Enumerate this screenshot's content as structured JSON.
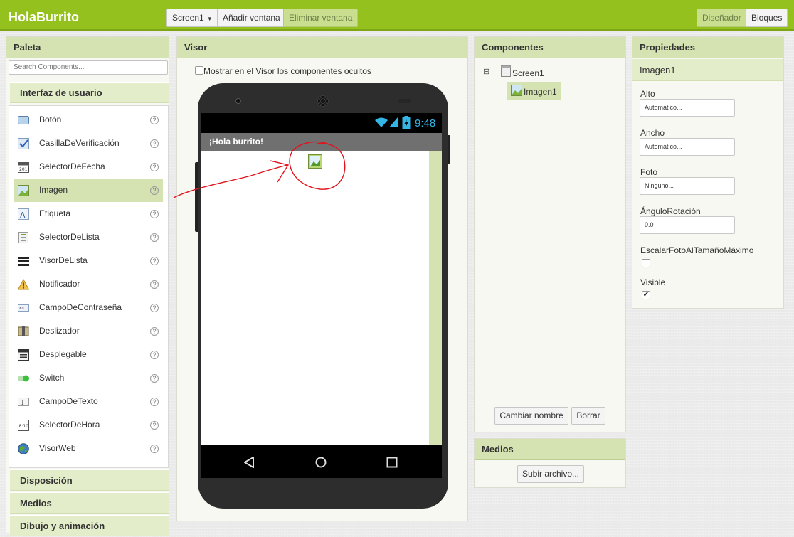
{
  "app": {
    "title": "HolaBurrito"
  },
  "toolbar": {
    "screen_select": "Screen1",
    "add_screen": "Añadir ventana",
    "remove_screen": "Eliminar ventana",
    "designer": "Diseñador",
    "blocks": "Bloques"
  },
  "palette": {
    "title": "Paleta",
    "search_placeholder": "Search Components...",
    "category_ui": "Interfaz de usuario",
    "items": [
      {
        "label": "Botón",
        "icon": "button-icon",
        "help": "?"
      },
      {
        "label": "CasillaDeVerificación",
        "icon": "checkbox-icon",
        "help": "?"
      },
      {
        "label": "SelectorDeFecha",
        "icon": "calendar-icon",
        "help": "?"
      },
      {
        "label": "Imagen",
        "icon": "image-icon",
        "help": "?"
      },
      {
        "label": "Etiqueta",
        "icon": "label-icon",
        "help": "?"
      },
      {
        "label": "SelectorDeLista",
        "icon": "list-picker-icon",
        "help": "?"
      },
      {
        "label": "VisorDeLista",
        "icon": "list-view-icon",
        "help": "?"
      },
      {
        "label": "Notificador",
        "icon": "warning-icon",
        "help": "?"
      },
      {
        "label": "CampoDeContraseña",
        "icon": "password-icon",
        "help": "?"
      },
      {
        "label": "Deslizador",
        "icon": "slider-icon",
        "help": "?"
      },
      {
        "label": "Desplegable",
        "icon": "spinner-icon",
        "help": "?"
      },
      {
        "label": "Switch",
        "icon": "switch-icon",
        "help": "?"
      },
      {
        "label": "CampoDeTexto",
        "icon": "textbox-icon",
        "help": "?"
      },
      {
        "label": "SelectorDeHora",
        "icon": "clock-icon",
        "help": "?"
      },
      {
        "label": "VisorWeb",
        "icon": "globe-icon",
        "help": "?"
      }
    ],
    "selected_item": "Imagen",
    "categories_collapsed": [
      "Disposición",
      "Medios",
      "Dibujo y animación"
    ]
  },
  "viewer": {
    "title": "Visor",
    "show_hidden_label": "Mostrar en el Visor los componentes ocultos",
    "phone_time": "9:48",
    "app_bar_title": "¡Hola burrito!"
  },
  "components": {
    "title": "Componentes",
    "tree_toggle": "⊟",
    "root": "Screen1",
    "child": "Imagen1",
    "rename_button": "Cambiar nombre",
    "delete_button": "Borrar"
  },
  "media": {
    "title": "Medios",
    "upload_button": "Subir archivo..."
  },
  "properties": {
    "title": "Propiedades",
    "component_name": "Imagen1",
    "height_label": "Alto",
    "height_value": "Automático...",
    "width_label": "Ancho",
    "width_value": "Automático...",
    "picture_label": "Foto",
    "picture_value": "Ninguno...",
    "rotation_label": "ÁnguloRotación",
    "rotation_value": "0.0",
    "scale_label": "EscalarFotoAlTamañoMáximo",
    "scale_checked": false,
    "visible_label": "Visible",
    "visible_checked": "✔"
  },
  "colors": {
    "brand_green": "#95c11f",
    "panel_header": "#d4e3b1",
    "annotation_red": "#e0141e"
  }
}
